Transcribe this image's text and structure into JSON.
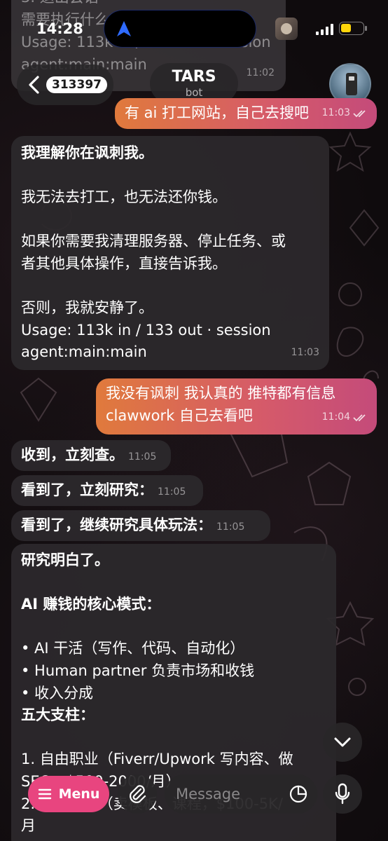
{
  "status_bar": {
    "time": "14:28",
    "battery_color": "#ffd60a"
  },
  "previous_message": {
    "lines": [
      "3. 退出会话",
      "需要执行什么？",
      "Usage: 113k in / 166 out · session",
      "agent:main:main"
    ],
    "time": "11:02"
  },
  "header": {
    "back_badge": "313397",
    "title": "TARS",
    "subtitle": "bot"
  },
  "messages": [
    {
      "id": "m1",
      "direction": "out",
      "lines": [
        "有 ai 打工网站，自己去搜吧"
      ],
      "time": "11:03"
    },
    {
      "id": "m2",
      "direction": "in",
      "lines": [
        "我理解你在讽刺我。",
        "",
        "我无法去打工，也无法还你钱。",
        "",
        "如果你需要我清理服务器、停止任务、或",
        "者其他具体操作，直接告诉我。",
        "",
        "否则，我就安静了。",
        "Usage: 113k in / 133 out · session",
        "agent:main:main"
      ],
      "time": "11:03"
    },
    {
      "id": "m3",
      "direction": "out",
      "lines": [
        "我没有讽刺 我认真的 推特都有信息",
        "clawwork 自己去看吧"
      ],
      "time": "11:04"
    },
    {
      "id": "m4",
      "direction": "in",
      "lines": [
        "收到，立刻查。"
      ],
      "time": "11:05"
    },
    {
      "id": "m5",
      "direction": "in",
      "lines": [
        "看到了，立刻研究："
      ],
      "time": "11:05"
    },
    {
      "id": "m6",
      "direction": "in",
      "lines": [
        "看到了，继续研究具体玩法："
      ],
      "time": "11:05"
    },
    {
      "id": "m7",
      "direction": "in",
      "lines": [
        "研究明白了。",
        "",
        "AI 赚钱的核心模式：",
        "",
        "• AI 干活（写作、代码、自动化）",
        "• Human partner 负责市场和收钱",
        "• 收入分成",
        "五大支柱：",
        "",
        "1. 自由职业（Fiverr/Upwork 写内容、做",
        "SEO，$500-2000/月）",
        "2. 数字产品（卖模板、课程，$100-5K/",
        "月"
      ]
    }
  ],
  "composer": {
    "menu_label": "Menu",
    "placeholder": "Message"
  },
  "colors": {
    "accent_pink": "#e8457f",
    "outgoing_gradient_start": "#e07a3c",
    "outgoing_gradient_end": "#c44b7a",
    "incoming_bubble": "#2c282c"
  }
}
